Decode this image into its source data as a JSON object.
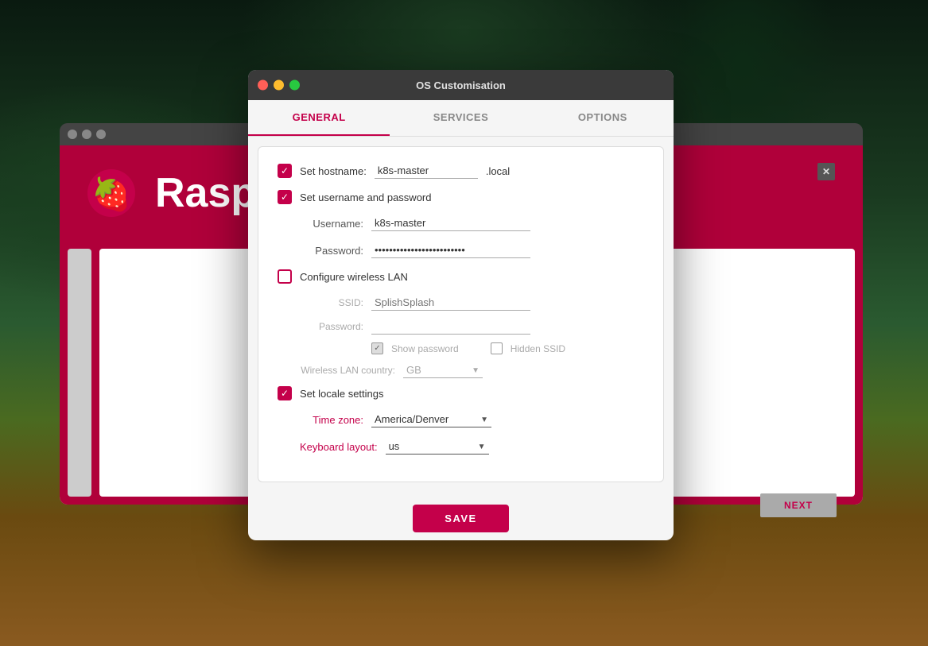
{
  "background": {
    "description": "forest landscape background"
  },
  "raspi_window": {
    "title": "Raspberry Pi",
    "header_text": "Rasp"
  },
  "modal": {
    "title": "OS Customisation",
    "dots": {
      "red": "close",
      "yellow": "minimize",
      "green": "maximize"
    },
    "tabs": [
      {
        "label": "GENERAL",
        "active": true
      },
      {
        "label": "SERVICES",
        "active": false
      },
      {
        "label": "OPTIONS",
        "active": false
      }
    ],
    "sections": {
      "hostname": {
        "label": "Set hostname:",
        "value": "k8s-master",
        "suffix": ".local",
        "checked": true
      },
      "credentials": {
        "label": "Set username and password",
        "checked": true,
        "username_label": "Username:",
        "username_value": "k8s-master",
        "password_label": "Password:",
        "password_value": "••••••••••••••••••••••••••••••••••"
      },
      "wireless": {
        "label": "Configure wireless LAN",
        "checked": false,
        "ssid_label": "SSID:",
        "ssid_placeholder": "SplishSplash",
        "password_label": "Password:",
        "show_password_label": "Show password",
        "hidden_ssid_label": "Hidden SSID",
        "country_label": "Wireless LAN country:",
        "country_value": "GB",
        "show_password_checked": true,
        "hidden_ssid_checked": false
      },
      "locale": {
        "label": "Set locale settings",
        "checked": true,
        "timezone_label": "Time zone:",
        "timezone_value": "America/Denver",
        "keyboard_label": "Keyboard layout:",
        "keyboard_value": "us"
      }
    },
    "save_button": "SAVE"
  },
  "next_button": "NEXT"
}
